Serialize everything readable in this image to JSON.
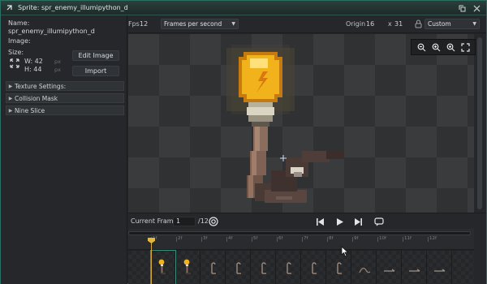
{
  "window": {
    "title": "Sprite: spr_enemy_illumipython_d"
  },
  "left": {
    "name_label": "Name:",
    "name_value": "spr_enemy_illumipython_d",
    "image_label": "Image:",
    "size_label": "Size:",
    "width_value": "W: 42",
    "height_value": "H: 44",
    "unit_w": "px",
    "unit_h": "px",
    "edit_image_label": "Edit Image",
    "import_label": "Import",
    "sections": [
      "Texture Settings:",
      "Collision Mask",
      "Nine Slice"
    ]
  },
  "toolbar": {
    "fps_label": "Fps",
    "fps_value": "12",
    "speed_mode": "Frames per second",
    "origin_label": "Origin",
    "origin_x": "16",
    "origin_sep": "x",
    "origin_y": "31",
    "origin_preset": "Custom"
  },
  "playback": {
    "current_frame_label": "Current Frame:",
    "current_frame_value": "1",
    "total_frames": "/12"
  },
  "timeline": {
    "frame_labels": [
      "1f",
      "2f",
      "3f",
      "4f",
      "5f",
      "6f",
      "7f",
      "8f",
      "9f",
      "10f",
      "11f",
      "12f"
    ],
    "current_frame": 1
  },
  "colors": {
    "accent": "#2e6f63",
    "playhead": "#e3b63c",
    "flame": "#f2b21c",
    "snake_body": "#4a3a36"
  }
}
